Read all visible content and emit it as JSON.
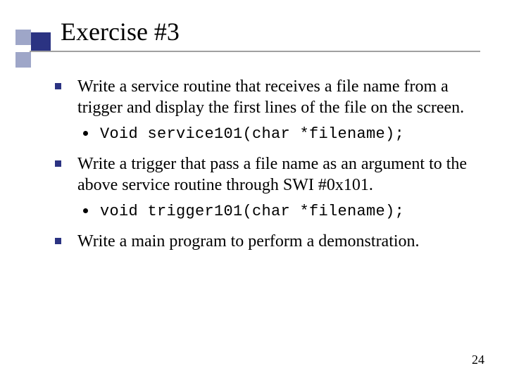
{
  "title": "Exercise #3",
  "bullets": [
    {
      "text": "Write a service routine that receives a file name from a trigger and display the first lines of the file on the screen.",
      "sub": [
        "Void service101(char *filename);"
      ]
    },
    {
      "text": "Write a trigger that pass a file name as an argument to the above service routine through SWI #0x101.",
      "sub": [
        "void trigger101(char *filename);"
      ]
    },
    {
      "text": "Write a main program to perform a demonstration.",
      "sub": []
    }
  ],
  "page_number": "24",
  "colors": {
    "accent_dark": "#2b3382",
    "accent_light": "#9ea6c8",
    "underline": "#a0a0a0"
  }
}
